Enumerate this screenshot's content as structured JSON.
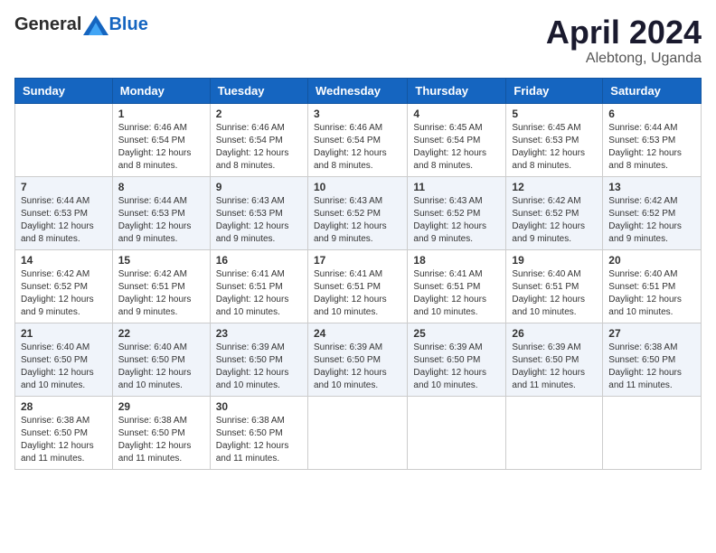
{
  "header": {
    "logo": {
      "general": "General",
      "blue": "Blue"
    },
    "title": "April 2024",
    "location": "Alebtong, Uganda"
  },
  "days_of_week": [
    "Sunday",
    "Monday",
    "Tuesday",
    "Wednesday",
    "Thursday",
    "Friday",
    "Saturday"
  ],
  "weeks": [
    [
      {
        "day": "",
        "info": ""
      },
      {
        "day": "1",
        "info": "Sunrise: 6:46 AM\nSunset: 6:54 PM\nDaylight: 12 hours and 8 minutes."
      },
      {
        "day": "2",
        "info": "Sunrise: 6:46 AM\nSunset: 6:54 PM\nDaylight: 12 hours and 8 minutes."
      },
      {
        "day": "3",
        "info": "Sunrise: 6:46 AM\nSunset: 6:54 PM\nDaylight: 12 hours and 8 minutes."
      },
      {
        "day": "4",
        "info": "Sunrise: 6:45 AM\nSunset: 6:54 PM\nDaylight: 12 hours and 8 minutes."
      },
      {
        "day": "5",
        "info": "Sunrise: 6:45 AM\nSunset: 6:53 PM\nDaylight: 12 hours and 8 minutes."
      },
      {
        "day": "6",
        "info": "Sunrise: 6:44 AM\nSunset: 6:53 PM\nDaylight: 12 hours and 8 minutes."
      }
    ],
    [
      {
        "day": "7",
        "info": "Sunrise: 6:44 AM\nSunset: 6:53 PM\nDaylight: 12 hours and 8 minutes."
      },
      {
        "day": "8",
        "info": "Sunrise: 6:44 AM\nSunset: 6:53 PM\nDaylight: 12 hours and 9 minutes."
      },
      {
        "day": "9",
        "info": "Sunrise: 6:43 AM\nSunset: 6:53 PM\nDaylight: 12 hours and 9 minutes."
      },
      {
        "day": "10",
        "info": "Sunrise: 6:43 AM\nSunset: 6:52 PM\nDaylight: 12 hours and 9 minutes."
      },
      {
        "day": "11",
        "info": "Sunrise: 6:43 AM\nSunset: 6:52 PM\nDaylight: 12 hours and 9 minutes."
      },
      {
        "day": "12",
        "info": "Sunrise: 6:42 AM\nSunset: 6:52 PM\nDaylight: 12 hours and 9 minutes."
      },
      {
        "day": "13",
        "info": "Sunrise: 6:42 AM\nSunset: 6:52 PM\nDaylight: 12 hours and 9 minutes."
      }
    ],
    [
      {
        "day": "14",
        "info": "Sunrise: 6:42 AM\nSunset: 6:52 PM\nDaylight: 12 hours and 9 minutes."
      },
      {
        "day": "15",
        "info": "Sunrise: 6:42 AM\nSunset: 6:51 PM\nDaylight: 12 hours and 9 minutes."
      },
      {
        "day": "16",
        "info": "Sunrise: 6:41 AM\nSunset: 6:51 PM\nDaylight: 12 hours and 10 minutes."
      },
      {
        "day": "17",
        "info": "Sunrise: 6:41 AM\nSunset: 6:51 PM\nDaylight: 12 hours and 10 minutes."
      },
      {
        "day": "18",
        "info": "Sunrise: 6:41 AM\nSunset: 6:51 PM\nDaylight: 12 hours and 10 minutes."
      },
      {
        "day": "19",
        "info": "Sunrise: 6:40 AM\nSunset: 6:51 PM\nDaylight: 12 hours and 10 minutes."
      },
      {
        "day": "20",
        "info": "Sunrise: 6:40 AM\nSunset: 6:51 PM\nDaylight: 12 hours and 10 minutes."
      }
    ],
    [
      {
        "day": "21",
        "info": "Sunrise: 6:40 AM\nSunset: 6:50 PM\nDaylight: 12 hours and 10 minutes."
      },
      {
        "day": "22",
        "info": "Sunrise: 6:40 AM\nSunset: 6:50 PM\nDaylight: 12 hours and 10 minutes."
      },
      {
        "day": "23",
        "info": "Sunrise: 6:39 AM\nSunset: 6:50 PM\nDaylight: 12 hours and 10 minutes."
      },
      {
        "day": "24",
        "info": "Sunrise: 6:39 AM\nSunset: 6:50 PM\nDaylight: 12 hours and 10 minutes."
      },
      {
        "day": "25",
        "info": "Sunrise: 6:39 AM\nSunset: 6:50 PM\nDaylight: 12 hours and 10 minutes."
      },
      {
        "day": "26",
        "info": "Sunrise: 6:39 AM\nSunset: 6:50 PM\nDaylight: 12 hours and 11 minutes."
      },
      {
        "day": "27",
        "info": "Sunrise: 6:38 AM\nSunset: 6:50 PM\nDaylight: 12 hours and 11 minutes."
      }
    ],
    [
      {
        "day": "28",
        "info": "Sunrise: 6:38 AM\nSunset: 6:50 PM\nDaylight: 12 hours and 11 minutes."
      },
      {
        "day": "29",
        "info": "Sunrise: 6:38 AM\nSunset: 6:50 PM\nDaylight: 12 hours and 11 minutes."
      },
      {
        "day": "30",
        "info": "Sunrise: 6:38 AM\nSunset: 6:50 PM\nDaylight: 12 hours and 11 minutes."
      },
      {
        "day": "",
        "info": ""
      },
      {
        "day": "",
        "info": ""
      },
      {
        "day": "",
        "info": ""
      },
      {
        "day": "",
        "info": ""
      }
    ]
  ]
}
